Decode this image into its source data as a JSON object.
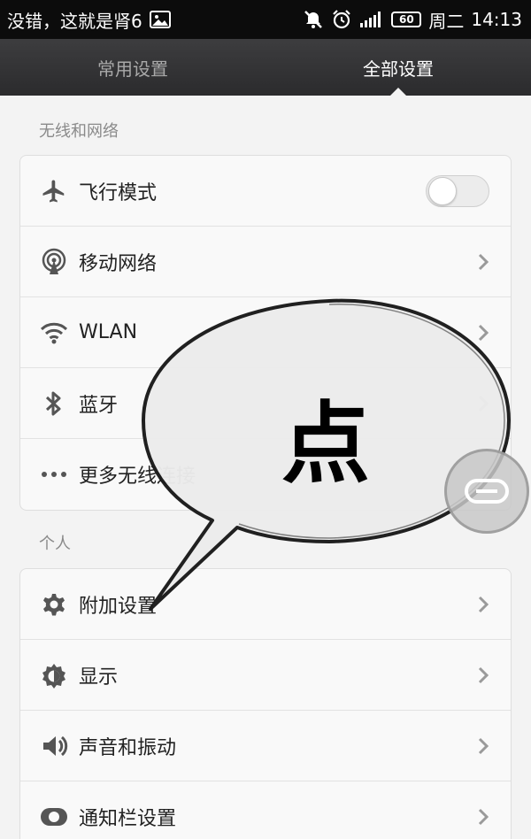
{
  "status_bar": {
    "carrier_text": "没错，这就是肾6",
    "battery_level": "60",
    "day": "周二",
    "time": "14:13",
    "icons": [
      "image-icon",
      "mute-icon",
      "alarm-icon",
      "signal-icon",
      "battery-icon"
    ]
  },
  "tabs": [
    {
      "label": "常用设置",
      "active": false
    },
    {
      "label": "全部设置",
      "active": true
    }
  ],
  "sections": [
    {
      "title": "无线和网络",
      "items": [
        {
          "label": "飞行模式",
          "icon": "airplane-icon",
          "control": "toggle",
          "toggle_on": false
        },
        {
          "label": "移动网络",
          "icon": "antenna-icon",
          "control": "chevron"
        },
        {
          "label": "WLAN",
          "icon": "wifi-icon",
          "control": "chevron"
        },
        {
          "label": "蓝牙",
          "icon": "bluetooth-icon",
          "control": "chevron"
        },
        {
          "label": "更多无线连接",
          "icon": "more-dots-icon",
          "control": "none"
        }
      ]
    },
    {
      "title": "个人",
      "items": [
        {
          "label": "附加设置",
          "icon": "gear-icon",
          "control": "chevron"
        },
        {
          "label": "显示",
          "icon": "brightness-icon",
          "control": "chevron"
        },
        {
          "label": "声音和振动",
          "icon": "sound-icon",
          "control": "chevron"
        },
        {
          "label": "通知栏设置",
          "icon": "notification-toggle-icon",
          "control": "chevron"
        }
      ]
    }
  ],
  "annotation": {
    "bubble_text": "点"
  },
  "colors": {
    "status_bar_bg": "#0c0c0c",
    "tab_bar_bg": "#333335",
    "active_tab_text": "#ffffff",
    "inactive_tab_text": "#a9a9a9",
    "page_bg": "#f3f3f3"
  }
}
